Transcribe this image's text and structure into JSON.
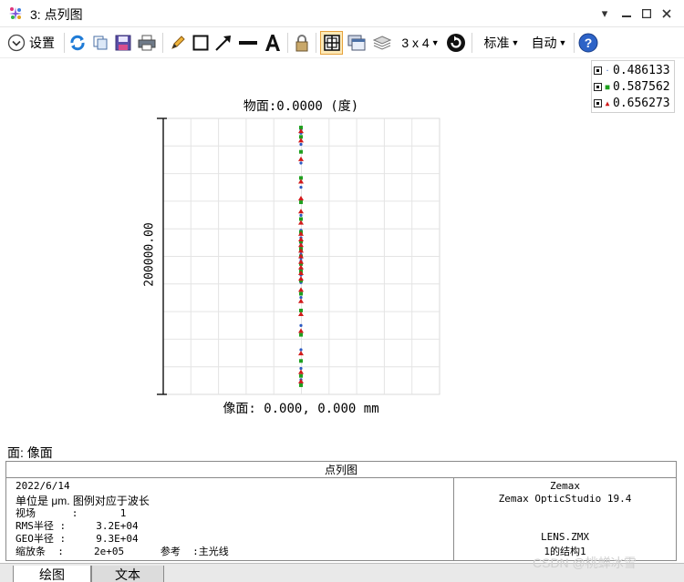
{
  "window": {
    "title": "3: 点列图"
  },
  "toolbar": {
    "settings_label": "设置",
    "layout_label": "3 x 4",
    "standard_label": "标准",
    "auto_label": "自动"
  },
  "legend": [
    {
      "value": "0.486133",
      "color": "#2b59c3",
      "marker": "·"
    },
    {
      "value": "0.587562",
      "color": "#1fa01f",
      "marker": "■"
    },
    {
      "value": "0.656273",
      "color": "#d11a1a",
      "marker": "▲"
    }
  ],
  "chart_data": {
    "type": "scatter",
    "title": "物面:0.0000 (度)",
    "xlabel": "像面: 0.000, 0.000 mm",
    "ylabel": "200000.00",
    "grid": true,
    "series": [
      {
        "name": "0.486133",
        "color": "#2b59c3",
        "points_y": [
          -6.8,
          -6.6,
          -6.0,
          -5.0,
          -3.7,
          -2.2,
          -1.4,
          -1.0,
          -0.7,
          -0.45,
          -0.25,
          -0.1,
          0.0,
          0.1,
          0.25,
          0.45,
          0.7,
          1.0,
          1.4,
          2.2,
          3.7,
          5.0,
          6.0,
          6.6,
          6.8
        ]
      },
      {
        "name": "0.587562",
        "color": "#1fa01f",
        "points_y": [
          -6.9,
          -6.4,
          -5.6,
          -4.2,
          -2.9,
          -2.0,
          -1.3,
          -0.8,
          -0.4,
          0.0,
          0.4,
          0.8,
          1.3,
          2.0,
          2.9,
          4.2,
          5.6,
          6.4,
          6.9
        ]
      },
      {
        "name": "0.656273",
        "color": "#d11a1a",
        "points_y": [
          -6.7,
          -6.2,
          -5.2,
          -4.0,
          -3.1,
          -2.4,
          -1.8,
          -1.2,
          -0.9,
          -0.6,
          -0.3,
          0.0,
          0.3,
          0.6,
          0.9,
          1.2,
          1.8,
          2.4,
          3.1,
          4.0,
          5.2,
          6.2,
          6.7
        ]
      }
    ]
  },
  "surface_label": "面: 像面",
  "info": {
    "header": "点列图",
    "date": "2022/6/14",
    "units_line": "单位是 μm. 图例对应于波长",
    "field_line": "视场      :       1",
    "rms_line": "RMS半径 :     3.2E+04",
    "geo_line": "GEO半径 :     9.3E+04",
    "scale_line": "缩放条  :     2e+05      参考  :主光线",
    "vendor": "Zemax",
    "product": "Zemax OpticStudio 19.4",
    "file": "LENS.ZMX",
    "config": "1的结构1"
  },
  "tabs": {
    "plot": "绘图",
    "text": "文本"
  },
  "watermark": "CSDN @桃蝉冰雪"
}
